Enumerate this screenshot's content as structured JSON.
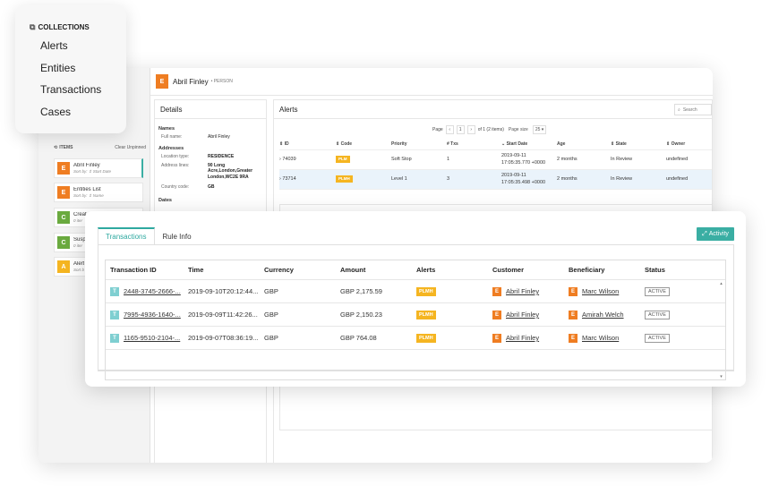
{
  "collections": {
    "title": "COLLECTIONS",
    "items": [
      "Alerts",
      "Entities",
      "Transactions",
      "Cases"
    ]
  },
  "sidebar": {
    "items_label": "ITEMS",
    "clear_label": "Clear Unpinned",
    "sessions": [
      {
        "badge": "E",
        "title": "Abril Finley",
        "sub": "Sort by: ⇕ Start Date"
      },
      {
        "badge": "E",
        "title": "Entities List",
        "sub": "Sort by: ⇕ Name"
      },
      {
        "badge": "C",
        "title": "Creat",
        "sub": "0 iter"
      },
      {
        "badge": "C",
        "title": "Susp",
        "sub": "0 iter"
      },
      {
        "badge": "A",
        "title": "Alert",
        "sub": "Sort b"
      }
    ]
  },
  "header": {
    "badge": "E",
    "name": "Abril Finley",
    "type": "• PERSON"
  },
  "details": {
    "title": "Details",
    "names_label": "Names",
    "full_name_key": "Full name:",
    "full_name": "Abril Finley",
    "addresses_label": "Addresses",
    "location_type_key": "Location type:",
    "location_type": "RESIDENCE",
    "address_lines_key": "Address lines:",
    "address_lines": "90 Long Acre,London,Greater London,WC2E 9RA",
    "country_code_key": "Country code:",
    "country_code": "GB",
    "dates_label": "Dates"
  },
  "alerts": {
    "title": "Alerts",
    "search_placeholder": "Search",
    "pager": {
      "page_label": "Page",
      "page": "1",
      "of_label": "of 1 (2 items)",
      "size_label": "Page size",
      "size": "25"
    },
    "columns": [
      "⇕ ID",
      "⇕ Code",
      "Priority",
      "# Txs",
      "⌄ Start Date",
      "Age",
      "⇕ State",
      "⇕ Owner"
    ],
    "rows": [
      {
        "id": "74039",
        "code": "PLM",
        "priority": "Soft Stop",
        "txs": "1",
        "start_date": "2019-09-11",
        "start_time": "17:05:35.770 +0000",
        "age": "2 months",
        "state": "In Review",
        "owner": "undefined"
      },
      {
        "id": "73714",
        "code": "PLMH",
        "priority": "Level 1",
        "txs": "3",
        "start_date": "2019-09-11",
        "start_time": "17:05:35.498 +0000",
        "age": "2 months",
        "state": "In Review",
        "owner": "undefined"
      }
    ]
  },
  "tx_card": {
    "tabs": [
      "Transactions",
      "Rule Info"
    ],
    "activity_label": "Activity",
    "columns": [
      "Transaction ID",
      "Time",
      "Currency",
      "Amount",
      "Alerts",
      "Customer",
      "Beneficiary",
      "Status"
    ],
    "rows": [
      {
        "badge": "T",
        "id": "2448-3745-2666-...",
        "time": "2019-09-10T20:12:44...",
        "currency": "GBP",
        "amount": "GBP 2,175.59",
        "alert": "PLMH",
        "customer": "Abril Finley",
        "beneficiary": "Marc Wilson",
        "status": "ACTIVE"
      },
      {
        "badge": "T",
        "id": "7995-4936-1640-...",
        "time": "2019-09-09T11:42:26...",
        "currency": "GBP",
        "amount": "GBP 2,150.23",
        "alert": "PLMH",
        "customer": "Abril Finley",
        "beneficiary": "Amirah Welch",
        "status": "ACTIVE"
      },
      {
        "badge": "T",
        "id": "1165-9510-2104-...",
        "time": "2019-09-07T08:36:19...",
        "currency": "GBP",
        "amount": "GBP 764.08",
        "alert": "PLMH",
        "customer": "Abril Finley",
        "beneficiary": "Marc Wilson",
        "status": "ACTIVE"
      }
    ],
    "entity_badge": "E"
  },
  "colors": {
    "accent": "#3aaea3",
    "entity": "#ef7d22",
    "case": "#6aaa3f",
    "alert": "#f5b521",
    "transaction": "#7fcfd1"
  }
}
